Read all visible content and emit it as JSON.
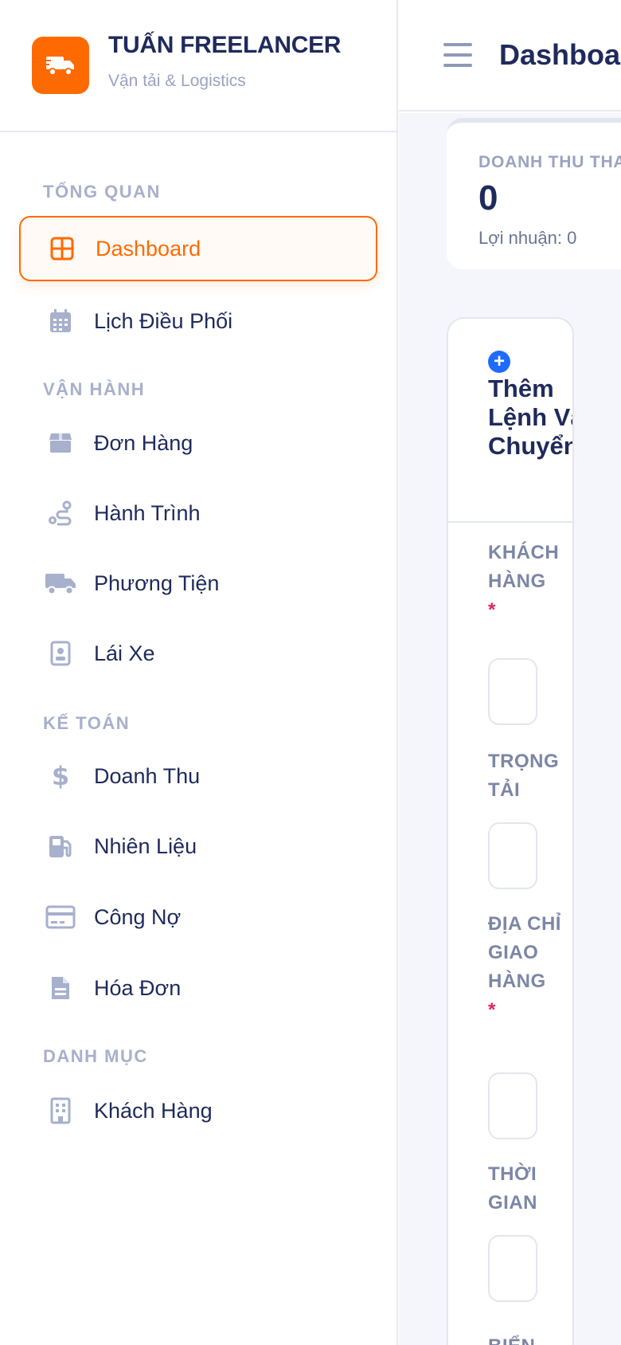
{
  "brand": {
    "title": "TUẤN FREELANCER",
    "subtitle": "Vận tải & Logistics"
  },
  "sidebar": {
    "sections": [
      {
        "label": "TỔNG QUAN"
      },
      {
        "label": "VẬN HÀNH"
      },
      {
        "label": "KẾ TOÁN"
      },
      {
        "label": "DANH MỤC"
      }
    ],
    "items": [
      {
        "label": "Dashboard",
        "icon": "grid-icon",
        "active": true
      },
      {
        "label": "Lịch Điều Phối",
        "icon": "calendar-icon"
      },
      {
        "label": "Đơn Hàng",
        "icon": "box-icon"
      },
      {
        "label": "Hành Trình",
        "icon": "route-icon"
      },
      {
        "label": "Phương Tiện",
        "icon": "truck-icon"
      },
      {
        "label": "Lái Xe",
        "icon": "id-badge-icon"
      },
      {
        "label": "Doanh Thu",
        "icon": "dollar-icon"
      },
      {
        "label": "Nhiên Liệu",
        "icon": "fuel-pump-icon"
      },
      {
        "label": "Công Nợ",
        "icon": "credit-card-icon"
      },
      {
        "label": "Hóa Đơn",
        "icon": "file-invoice-icon"
      },
      {
        "label": "Khách Hàng",
        "icon": "building-icon"
      }
    ]
  },
  "header": {
    "title": "Dashboa"
  },
  "stat": {
    "label": "DOANH THU THA",
    "value": "0",
    "sub": "Lợi nhuận: 0"
  },
  "form": {
    "title": "Thêm Lệnh Vận Chuyển",
    "fields": [
      {
        "label": "KHÁCH HÀNG",
        "required": "*"
      },
      {
        "label": "TRỌNG TẢI"
      },
      {
        "label": "ĐỊA CHỈ GIAO HÀNG",
        "required": "*"
      },
      {
        "label": "THỜI GIAN"
      },
      {
        "label": "BIỂN"
      }
    ]
  },
  "colors": {
    "accent": "#ff6a00",
    "primary_text": "#1f2a5c",
    "muted": "#a7b0cc",
    "blue": "#1f6bff"
  }
}
